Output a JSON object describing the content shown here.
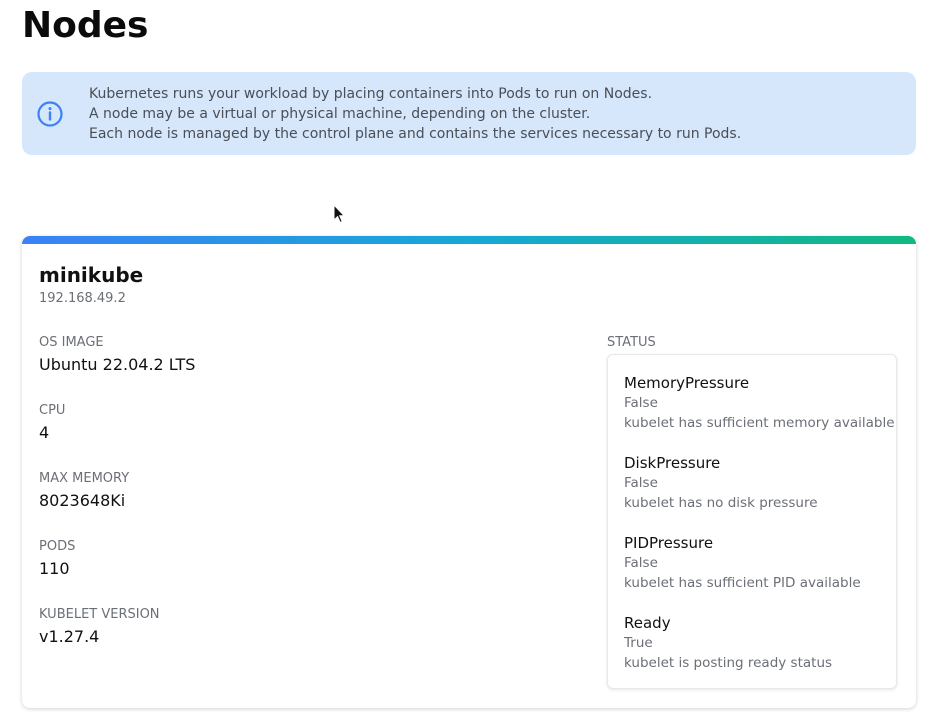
{
  "page": {
    "title": "Nodes"
  },
  "info": {
    "lines": [
      "Kubernetes runs your workload by placing containers into Pods to run on Nodes.",
      "A node may be a virtual or physical machine, depending on the cluster.",
      "Each node is managed by the control plane and contains the services necessary to run Pods."
    ],
    "icon": "info-icon",
    "background": "#d6e6fb",
    "icon_color": "#3b82f6"
  },
  "node": {
    "name": "minikube",
    "address": "192.168.49.2",
    "accent_gradient": [
      "#3b82f6",
      "#10b981"
    ],
    "fields": [
      {
        "label": "OS IMAGE",
        "value": "Ubuntu 22.04.2 LTS"
      },
      {
        "label": "CPU",
        "value": "4"
      },
      {
        "label": "MAX MEMORY",
        "value": "8023648Ki"
      },
      {
        "label": "PODS",
        "value": "110"
      },
      {
        "label": "KUBELET VERSION",
        "value": "v1.27.4"
      }
    ],
    "status_label": "STATUS",
    "conditions": [
      {
        "type": "MemoryPressure",
        "status": "False",
        "message": "kubelet has sufficient memory available"
      },
      {
        "type": "DiskPressure",
        "status": "False",
        "message": "kubelet has no disk pressure"
      },
      {
        "type": "PIDPressure",
        "status": "False",
        "message": "kubelet has sufficient PID available"
      },
      {
        "type": "Ready",
        "status": "True",
        "message": "kubelet is posting ready status"
      }
    ]
  }
}
